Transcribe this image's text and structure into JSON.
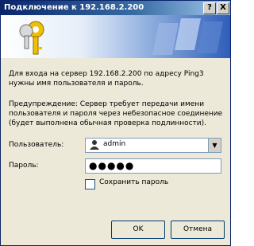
{
  "window": {
    "title": "Подключение к 192.168.2.200",
    "help_glyph": "?",
    "close_glyph": "X"
  },
  "banner": {
    "icon": "keys-icon"
  },
  "message": {
    "line1": "Для входа на сервер 192.168.2.200 по адресу Ping3",
    "line2": "нужны имя пользователя и пароль.",
    "warn1": "Предупреждение: Сервер требует передачи имени",
    "warn2": "пользователя и пароля через небезопасное соединение",
    "warn3": "(будет выполнена обычная проверка подлинности)."
  },
  "form": {
    "user_label": "Пользователь:",
    "user_value": "admin",
    "pass_label": "Пароль:",
    "pass_mask": "●●●●●",
    "remember_label": "Сохранить пароль",
    "remember_checked": false
  },
  "buttons": {
    "ok": "OK",
    "cancel": "Отмена"
  },
  "colors": {
    "titlebar": "#0a246a",
    "face": "#ece9d8"
  }
}
